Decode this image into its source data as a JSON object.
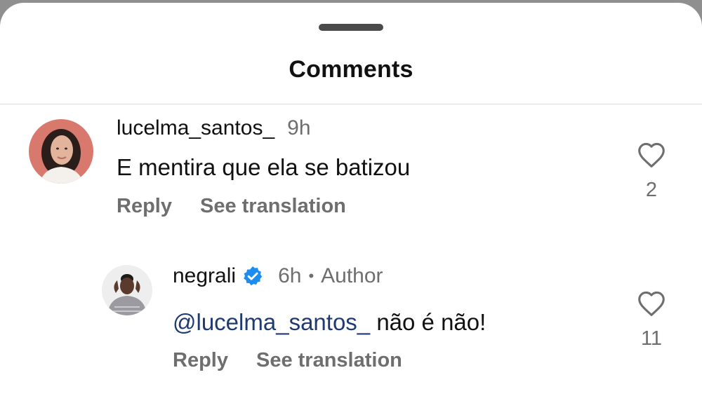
{
  "sheet": {
    "title": "Comments"
  },
  "comments": [
    {
      "username": "lucelma_santos_",
      "time": "9h",
      "text": "E mentira que ela se batizou",
      "reply_label": "Reply",
      "translate_label": "See translation",
      "likes": "2",
      "avatar_icon": "profile-photo"
    },
    {
      "username": "negrali",
      "verified_icon": "verified-badge-icon",
      "time": "6h",
      "separator": "•",
      "author_label": "Author",
      "mention": "@lucelma_santos_",
      "text": " não é não!",
      "reply_label": "Reply",
      "translate_label": "See translation",
      "likes": "11",
      "avatar_icon": "profile-photo"
    }
  ],
  "colors": {
    "verified_blue": "#1d8cf0",
    "mention_blue": "#1f3a73",
    "secondary_text": "#6e6e6e"
  }
}
